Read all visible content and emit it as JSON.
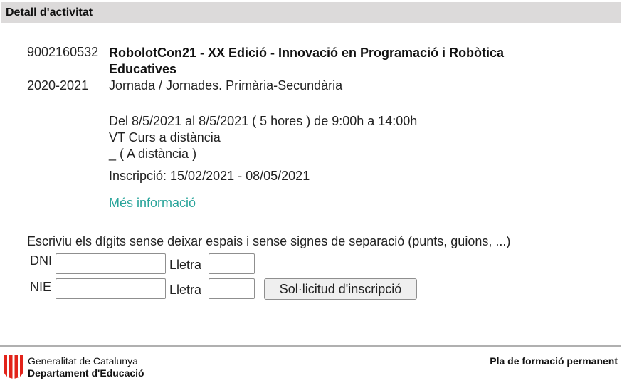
{
  "header": {
    "title": "Detall d'activitat"
  },
  "activity": {
    "code": "9002160532",
    "title": "RobolotCon21 - XX Edició - Innovació en Programació i Robòtica Educatives",
    "year": "2020-2021",
    "type": "Jornada / Jornades. Primària-Secundària",
    "date_range": "Del 8/5/2021 al 8/5/2021 ( 5 hores ) de 9:00h a 14:00h",
    "venue": "VT Curs a distància",
    "modality": "_ ( A distància )",
    "registration": "Inscripció: 15/02/2021 - 08/05/2021",
    "more_info_link": "Més informació"
  },
  "form": {
    "instructions": "Escriviu els dígits sense deixar espais i sense signes de separació (punts, guions, ...)",
    "dni_label": "DNI",
    "nie_label": "NIE",
    "letter_label": "Lletra",
    "dni_value": "",
    "dni_letter_value": "",
    "nie_value": "",
    "nie_letter_value": "",
    "submit_label": "Sol·licitud d'inscripció"
  },
  "footer": {
    "org_line1": "Generalitat de Catalunya",
    "org_line2": "Departament d'Educació",
    "program": "Pla de formació permanent",
    "logo_icon": "generalitat-logo-icon",
    "logo_color": "#e2231a"
  }
}
